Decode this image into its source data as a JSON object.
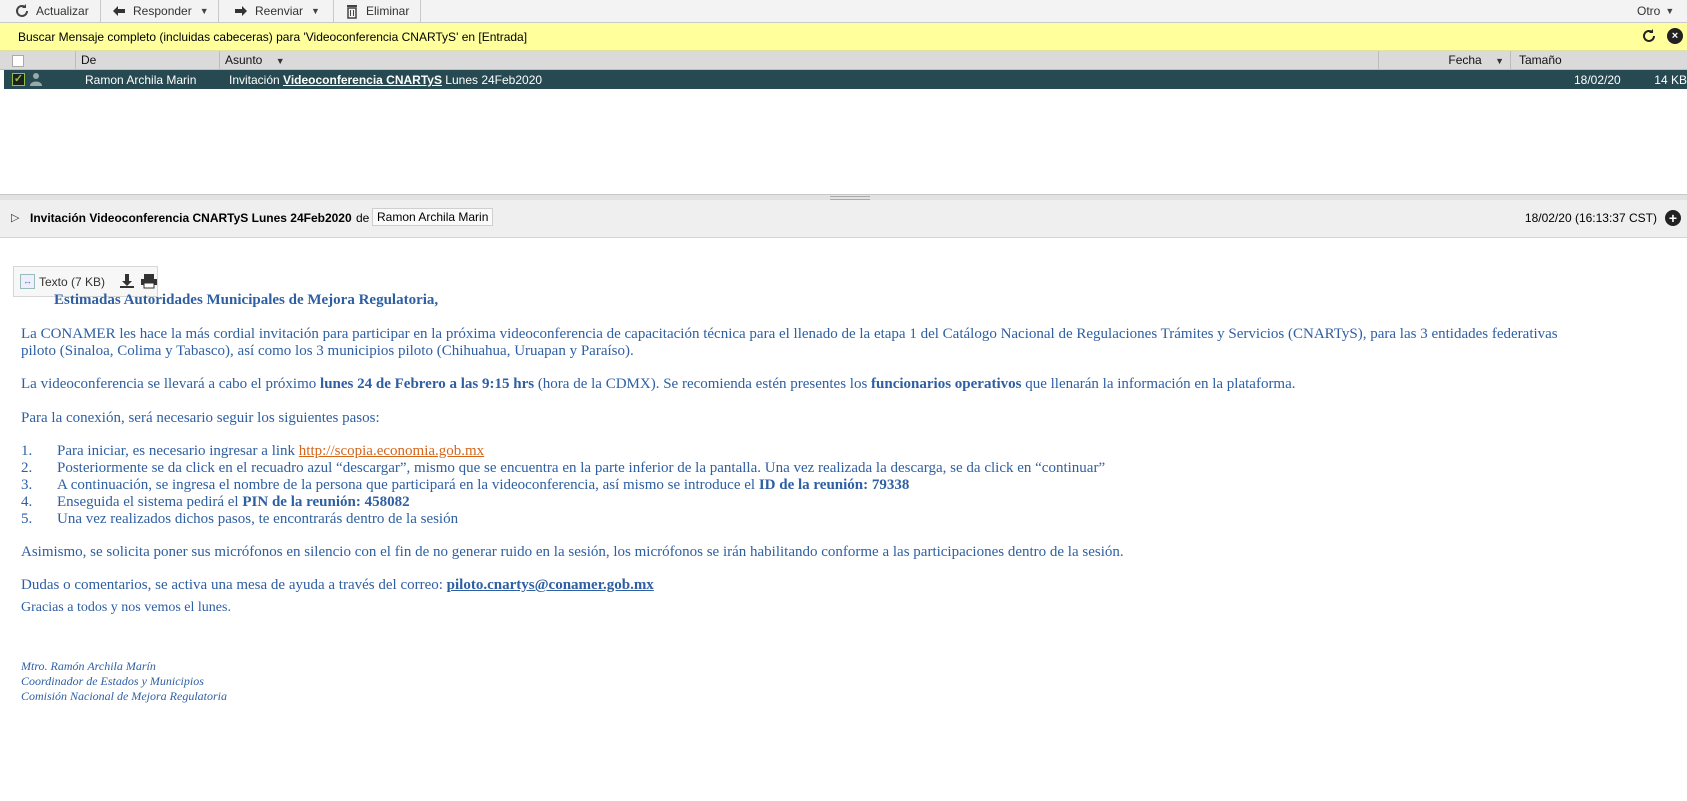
{
  "toolbar": {
    "refresh": "Actualizar",
    "reply": "Responder",
    "forward": "Reenviar",
    "delete": "Eliminar",
    "other": "Otro"
  },
  "search_notice": "Buscar Mensaje completo (incluidas cabeceras) para 'Videoconferencia CNARTyS' en [Entrada]",
  "list": {
    "columns": {
      "from": "De",
      "subject": "Asunto",
      "date": "Fecha",
      "size": "Tamaño"
    },
    "rows": [
      {
        "from": "Ramon Archila Marin",
        "subject_prefix": "Invitación ",
        "subject_match": "Videoconferencia CNARTyS",
        "subject_suffix": " Lunes 24Feb2020",
        "date": "18/02/20",
        "size": "14 KB"
      }
    ]
  },
  "preview": {
    "subject": "Invitación Videoconferencia CNARTyS Lunes 24Feb2020",
    "de": "de",
    "sender": "Ramon Archila Marin",
    "date": "18/02/20 (16:13:37 CST)",
    "attachment": "Texto (7 KB)"
  },
  "email": {
    "greeting": "Estimadas Autoridades Municipales de Mejora Regulatoria,",
    "p1_line1": "La CONAMER les hace la más cordial invitación para participar en la próxima videoconferencia de capacitación técnica para el llenado de la etapa 1 del Catálogo Nacional de Regulaciones Trámites y Servicios (CNARTyS), para las 3 entidades federativas",
    "p1_line2": "piloto (Sinaloa, Colima y Tabasco), así como los 3 municipios piloto (Chihuahua, Uruapan y Paraíso).",
    "p2_a": "La videoconferencia se llevará a cabo el próximo ",
    "p2_b": "lunes 24 de Febrero a las 9:15 hrs",
    "p2_c": " (hora de la CDMX). Se recomienda estén presentes los ",
    "p2_d": "funcionarios operativos",
    "p2_e": " que llenarán la información en la plataforma.",
    "p3": "Para la conexión, será necesario seguir los siguientes pasos:",
    "steps": {
      "n1": "1.",
      "s1_a": "Para iniciar, es necesario ingresar a link ",
      "s1_link": "http://scopia.economia.gob.mx",
      "n2": "2.",
      "s2": "Posteriormente se da click en el recuadro azul “descargar”, mismo que se encuentra en la parte inferior de la pantalla. Una vez realizada la descarga, se da click en “continuar”",
      "n3": "3.",
      "s3_a": "A continuación, se ingresa el nombre de la persona que participará en la videoconferencia, así mismo se introduce el ",
      "s3_b": "ID de la reunión: 79338",
      "n4": "4.",
      "s4_a": "Enseguida el sistema pedirá el ",
      "s4_b": "PIN de la reunión: 458082",
      "n5": "5.",
      "s5": "Una vez realizados dichos pasos, te encontrarás dentro de la sesión"
    },
    "p4": "Asimismo, se solicita poner sus micrófonos en silencio con el fin de no generar ruido en la sesión, los micrófonos se irán habilitando conforme a las participaciones dentro de la sesión.",
    "p5_a": "Dudas o comentarios, se activa una mesa de ayuda a través del correo: ",
    "p5_link": "piloto.cnartys@conamer.gob.mx",
    "p6": "Gracias a todos y nos vemos el lunes.",
    "sig1": "Mtro. Ramón Archila Marín",
    "sig2": "Coordinador de Estados y Municipios",
    "sig3": "Comisión Nacional de Mejora Regulatoria"
  },
  "colors": {
    "row_selected": "#274951",
    "search_bar": "#ffff9c",
    "email_text": "#2e5fa3",
    "link_orange": "#d4661b"
  },
  "icons": [
    "refresh-icon",
    "reply-arrow-icon",
    "forward-arrow-icon",
    "trash-icon",
    "close-icon",
    "person-icon",
    "download-icon",
    "print-icon",
    "plus-icon",
    "toggle-triangle-icon"
  ]
}
